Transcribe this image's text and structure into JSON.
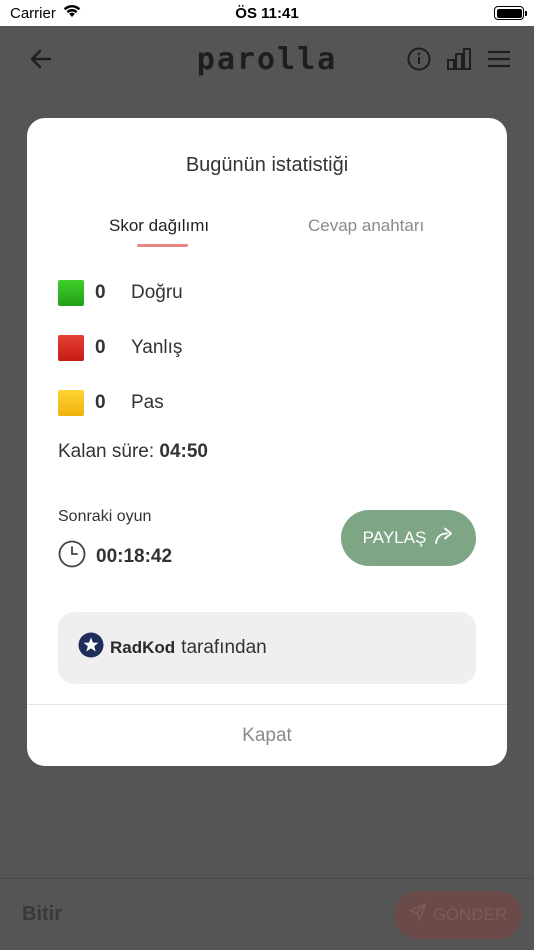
{
  "status_bar": {
    "carrier": "Carrier",
    "time": "ÖS 11:41"
  },
  "app": {
    "title": "parolla",
    "icons": {
      "back": "back-arrow-icon",
      "info": "info-icon",
      "stats": "bar-chart-icon",
      "menu": "menu-icon"
    },
    "bottom": {
      "finish_label": "Bitir",
      "send_label": "GÖNDER"
    }
  },
  "modal": {
    "title": "Bugünün istatistiği",
    "tabs": [
      {
        "label": "Skor dağılımı",
        "active": true
      },
      {
        "label": "Cevap anahtarı",
        "active": false
      }
    ],
    "scores": [
      {
        "value": "0",
        "label": "Doğru",
        "color": "#2fb51e"
      },
      {
        "value": "0",
        "label": "Yanlış",
        "color": "#d7281f"
      },
      {
        "value": "0",
        "label": "Pas",
        "color": "#f5c11a"
      }
    ],
    "remaining": {
      "label": "Kalan süre:",
      "value": "04:50"
    },
    "next_game": {
      "label": "Sonraki oyun",
      "time": "00:18:42"
    },
    "share_label": "PAYLAŞ",
    "credit": {
      "brand": "RadKod",
      "suffix": "tarafından"
    },
    "close_label": "Kapat"
  },
  "colors": {
    "accent_green": "#7ea685",
    "tab_underline": "#e88585",
    "overlay": "#555555"
  }
}
